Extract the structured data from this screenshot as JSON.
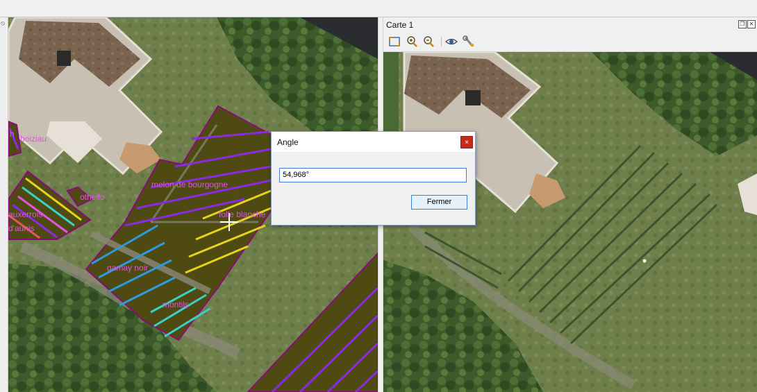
{
  "panel": {
    "title": "Carte 1",
    "float_icon": "restore-icon",
    "close_icon": "close-icon"
  },
  "toolbar": {
    "tools": [
      "zoom-full-icon",
      "zoom-in-icon",
      "zoom-out-icon",
      "layer-visibility-icon",
      "settings-wrench-icon"
    ]
  },
  "map_labels": {
    "boiziau": "boiziau",
    "h": "h",
    "othello": "othello",
    "auxerrois": "auxerrois",
    "daunis": "d'aunis",
    "melon": "melon de bourgogne",
    "folle": "folle blanche",
    "gamay": "gamay noir",
    "montils": "montils"
  },
  "dialog": {
    "title": "Angle",
    "value": "54,968°",
    "close_label": "×",
    "button_label": "Fermer"
  },
  "colors": {
    "label": "#e055e0",
    "parcel_outline": "#8a0a7a",
    "parcel_fill": "#4e4a12",
    "purple_rows": "#8a2be2",
    "blue_rows": "#2e9be0",
    "yellow_rows": "#e6d31a",
    "cyan_rows": "#3bd0c8",
    "orange_ticks": "#e08a1a",
    "close_red": "#c42b1c",
    "accent_blue": "#3c7fd6"
  }
}
